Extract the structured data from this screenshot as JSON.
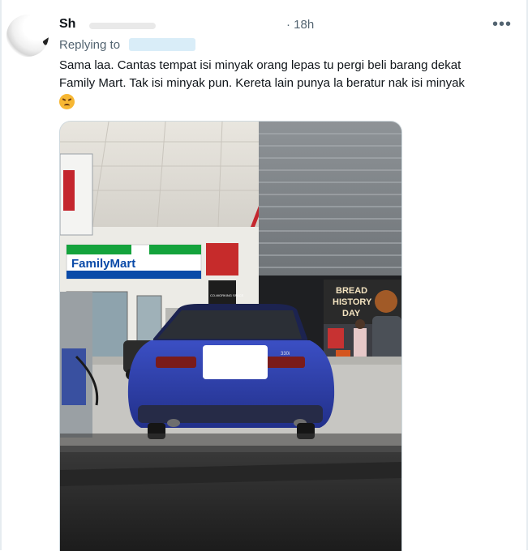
{
  "tweet": {
    "author_name": "Sh",
    "time": "· 18h",
    "more_label": "•••",
    "replying_label": "Replying to",
    "text_line1": "Sama laa. Cantas tempat isi minyak orang lepas tu pergi beli barang dekat",
    "text_line2": "Family Mart. Tak isi minyak pun. Kereta lain punya la beratur nak isi minyak",
    "emoji": "angry-face-icon"
  },
  "photo": {
    "store_sign": "FamilyMart",
    "poster_text": [
      "BREAD",
      "HISTORY",
      "DAY"
    ],
    "coworking_sign": "CO-WORKING SPACE",
    "car_badge": "330i",
    "colors": {
      "car": "#2f3fa8",
      "familymart_green": "#14a33c",
      "familymart_blue": "#0a4aa8",
      "canopy_red": "#c4262e"
    }
  }
}
